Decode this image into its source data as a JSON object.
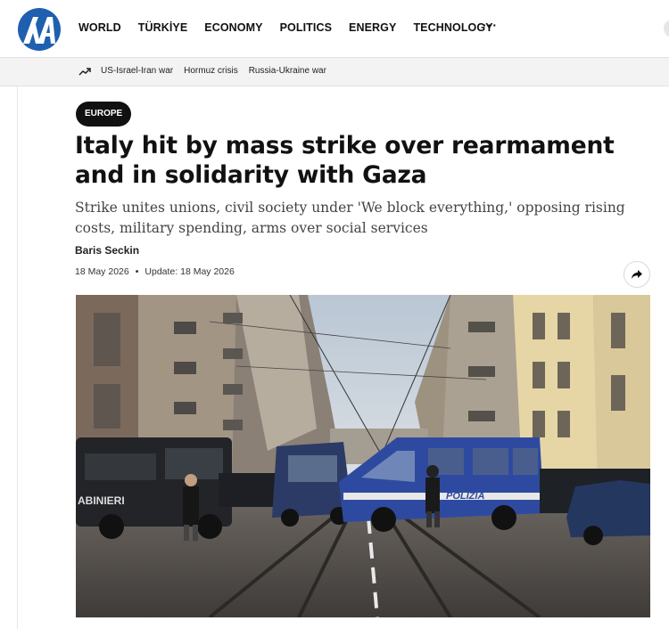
{
  "logo": {
    "text": "AA",
    "icon": "aa-logo"
  },
  "nav": {
    "items": [
      "WORLD",
      "TÜRKİYE",
      "ECONOMY",
      "POLITICS",
      "ENERGY",
      "TECHNOLOGY"
    ],
    "more": "···"
  },
  "trending": {
    "icon": "trending-arrow-icon",
    "links": [
      "US-Israel-Iran war",
      "Hormuz crisis",
      "Russia-Ukraine war"
    ]
  },
  "article": {
    "category": "EUROPE",
    "headline": "Italy hit by mass strike over rearmament and in solidarity with Gaza",
    "subtitle": "Strike unites unions, civil society under 'We block everything,' opposing rising costs, military spending, arms over social services",
    "author": "Baris Seckin",
    "published": "18 May 2026",
    "separator": "•",
    "updated": "Update: 18 May 2026",
    "share_icon": "share-arrow-icon",
    "photo": {
      "van_left_text": "ABINIERI",
      "van_right_text": "POLIZIA"
    }
  },
  "colors": {
    "ink": "#111111",
    "badge_bg": "#111111",
    "logo_blue": "#1f5fb0"
  }
}
